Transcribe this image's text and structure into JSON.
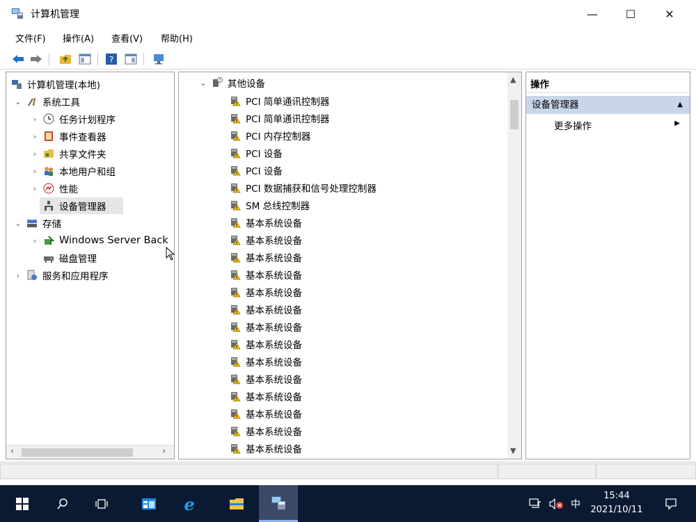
{
  "window": {
    "title": "计算机管理",
    "buttons": {
      "minimize": "—",
      "maximize": "☐",
      "close": "✕"
    }
  },
  "menu": [
    "文件(F)",
    "操作(A)",
    "查看(V)",
    "帮助(H)"
  ],
  "toolbar": [
    "back-icon",
    "forward-icon",
    "up-folder-icon",
    "show-hide-tree-icon",
    "help-icon",
    "properties-icon",
    "console-icon"
  ],
  "tree": {
    "root": "计算机管理(本地)",
    "system_tools": "系统工具",
    "items": [
      "任务计划程序",
      "事件查看器",
      "共享文件夹",
      "本地用户和组",
      "性能",
      "设备管理器"
    ],
    "storage": "存储",
    "storage_items": [
      "Windows Server Back",
      "磁盘管理"
    ],
    "services": "服务和应用程序"
  },
  "devices": {
    "category": "其他设备",
    "items": [
      "PCI 简单通讯控制器",
      "PCI 简单通讯控制器",
      "PCI 内存控制器",
      "PCI 设备",
      "PCI 设备",
      "PCI 数据捕获和信号处理控制器",
      "SM 总线控制器",
      "基本系统设备",
      "基本系统设备",
      "基本系统设备",
      "基本系统设备",
      "基本系统设备",
      "基本系统设备",
      "基本系统设备",
      "基本系统设备",
      "基本系统设备",
      "基本系统设备",
      "基本系统设备",
      "基本系统设备",
      "基本系统设备",
      "基本系统设备"
    ]
  },
  "actions": {
    "header": "操作",
    "section": "设备管理器",
    "more": "更多操作"
  },
  "taskbar": {
    "time": "15:44",
    "date": "2021/10/11",
    "ime": "中"
  },
  "colors": {
    "taskbar_bg": "#0b1a33",
    "selection": "#c9d6ea",
    "accent": "#0078d7"
  }
}
